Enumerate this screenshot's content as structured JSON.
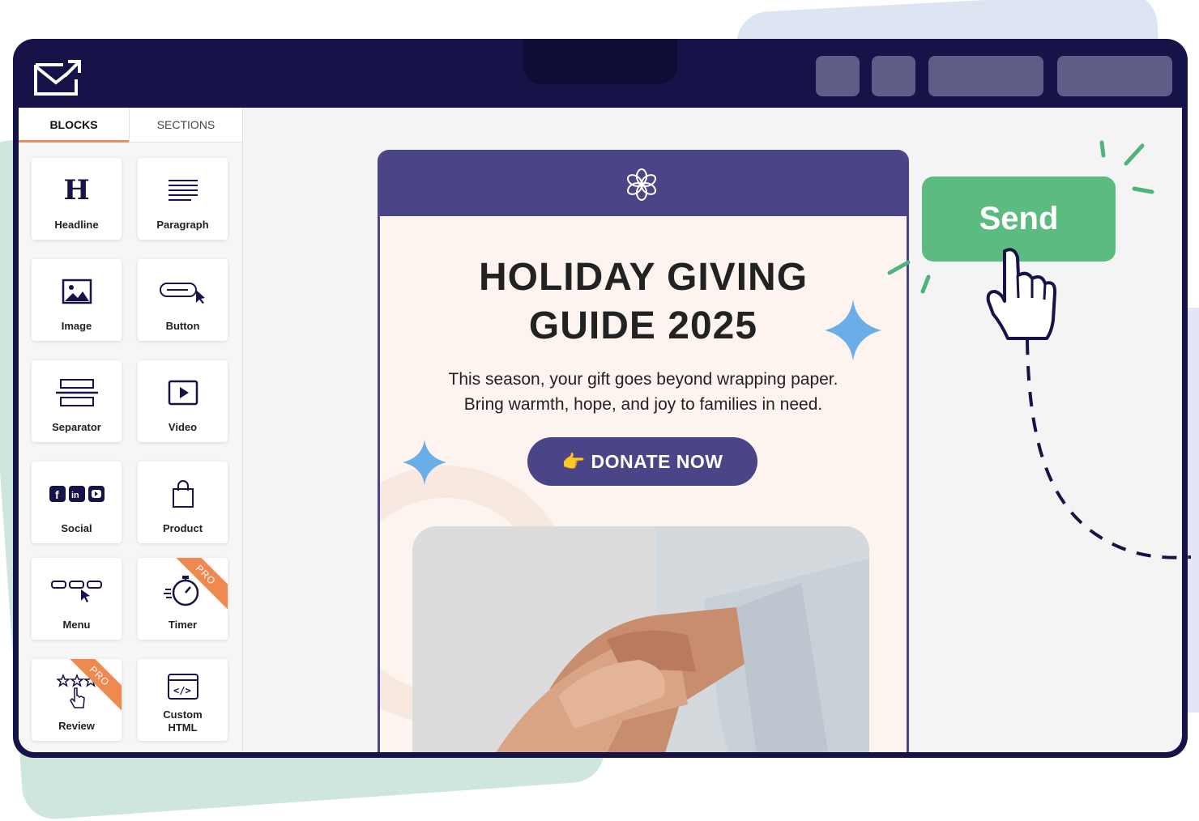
{
  "colors": {
    "window_bg": "#151347",
    "email_purple": "#4a4587",
    "email_bg": "#fdf4ef",
    "send_green": "#5cbb80",
    "pro_orange": "#f0894f",
    "tab_underline": "#f08a5d",
    "sparkle_blue": "#6aaee8"
  },
  "app": {
    "logo_icon": "mail-send-icon"
  },
  "sidebar": {
    "tabs": [
      {
        "label": "BLOCKS",
        "active": true
      },
      {
        "label": "SECTIONS",
        "active": false
      }
    ],
    "blocks": [
      {
        "label": "Headline",
        "icon": "headline-icon",
        "pro": false
      },
      {
        "label": "Paragraph",
        "icon": "paragraph-icon",
        "pro": false
      },
      {
        "label": "Image",
        "icon": "image-icon",
        "pro": false
      },
      {
        "label": "Button",
        "icon": "button-icon",
        "pro": false
      },
      {
        "label": "Separator",
        "icon": "separator-icon",
        "pro": false
      },
      {
        "label": "Video",
        "icon": "video-icon",
        "pro": false
      },
      {
        "label": "Social",
        "icon": "social-icon",
        "pro": false
      },
      {
        "label": "Product",
        "icon": "product-icon",
        "pro": false
      },
      {
        "label": "Menu",
        "icon": "menu-icon",
        "pro": false
      },
      {
        "label": "Timer",
        "icon": "timer-icon",
        "pro": true
      },
      {
        "label": "Review",
        "icon": "review-icon",
        "pro": true
      },
      {
        "label": "Custom\nHTML",
        "icon": "code-icon",
        "pro": false
      }
    ],
    "pro_label": "PRO"
  },
  "email": {
    "title_line1": "HOLIDAY GIVING",
    "title_line2": "GUIDE 2025",
    "body_line1": "This season, your gift goes beyond wrapping paper.",
    "body_line2": "Bring warmth, hope, and joy to families in need.",
    "donate_label": "👉 DONATE NOW"
  },
  "send": {
    "label": "Send"
  }
}
